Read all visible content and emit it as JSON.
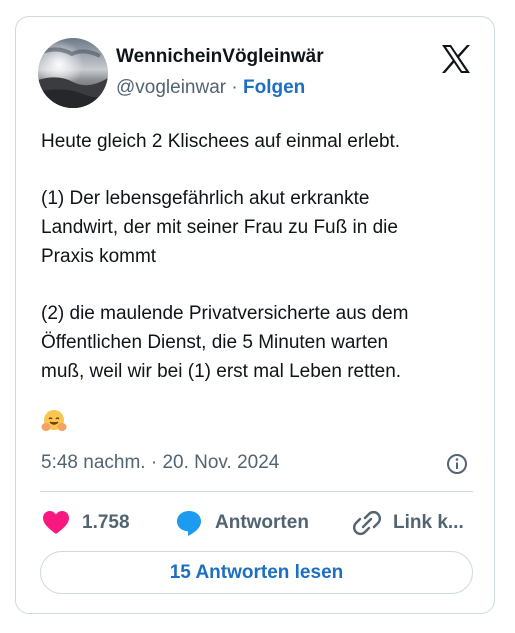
{
  "author": {
    "name": "WennicheinVögleinwär",
    "handle": "@vogleinwar",
    "separator": "·",
    "follow_label": "Folgen"
  },
  "tweet": {
    "lines": [
      "Heute gleich 2 Klischees auf einmal erlebt.",
      "(1) Der lebensgefährlich akut erkrankte",
      "Landwirt, der mit seiner Frau zu Fuß in die",
      "Praxis kommt",
      "(2) die maulende Privatversicherte aus dem",
      "Öffentlichen Dienst, die 5 Minuten warten",
      "muß, weil wir bei (1) erst mal Leben retten."
    ],
    "emoji": "hugging-face-emoji",
    "timestamp": "5:48 nachm. · 20. Nov. 2024"
  },
  "actions": {
    "like_count": "1.758",
    "reply_label": "Antworten",
    "copy_link_label": "Link k..."
  },
  "read_replies_label": "15 Antworten lesen",
  "icons": {
    "platform_logo": "x-logo-icon",
    "info": "info-icon",
    "like": "heart-icon",
    "reply": "speech-bubble-icon",
    "copy": "link-icon"
  },
  "colors": {
    "accent_blue": "#1d6fc4",
    "like_pink": "#f91880",
    "reply_blue": "#1d9bf0",
    "text_primary": "#0f1419",
    "text_secondary": "#536471",
    "border": "#cfd9de"
  }
}
